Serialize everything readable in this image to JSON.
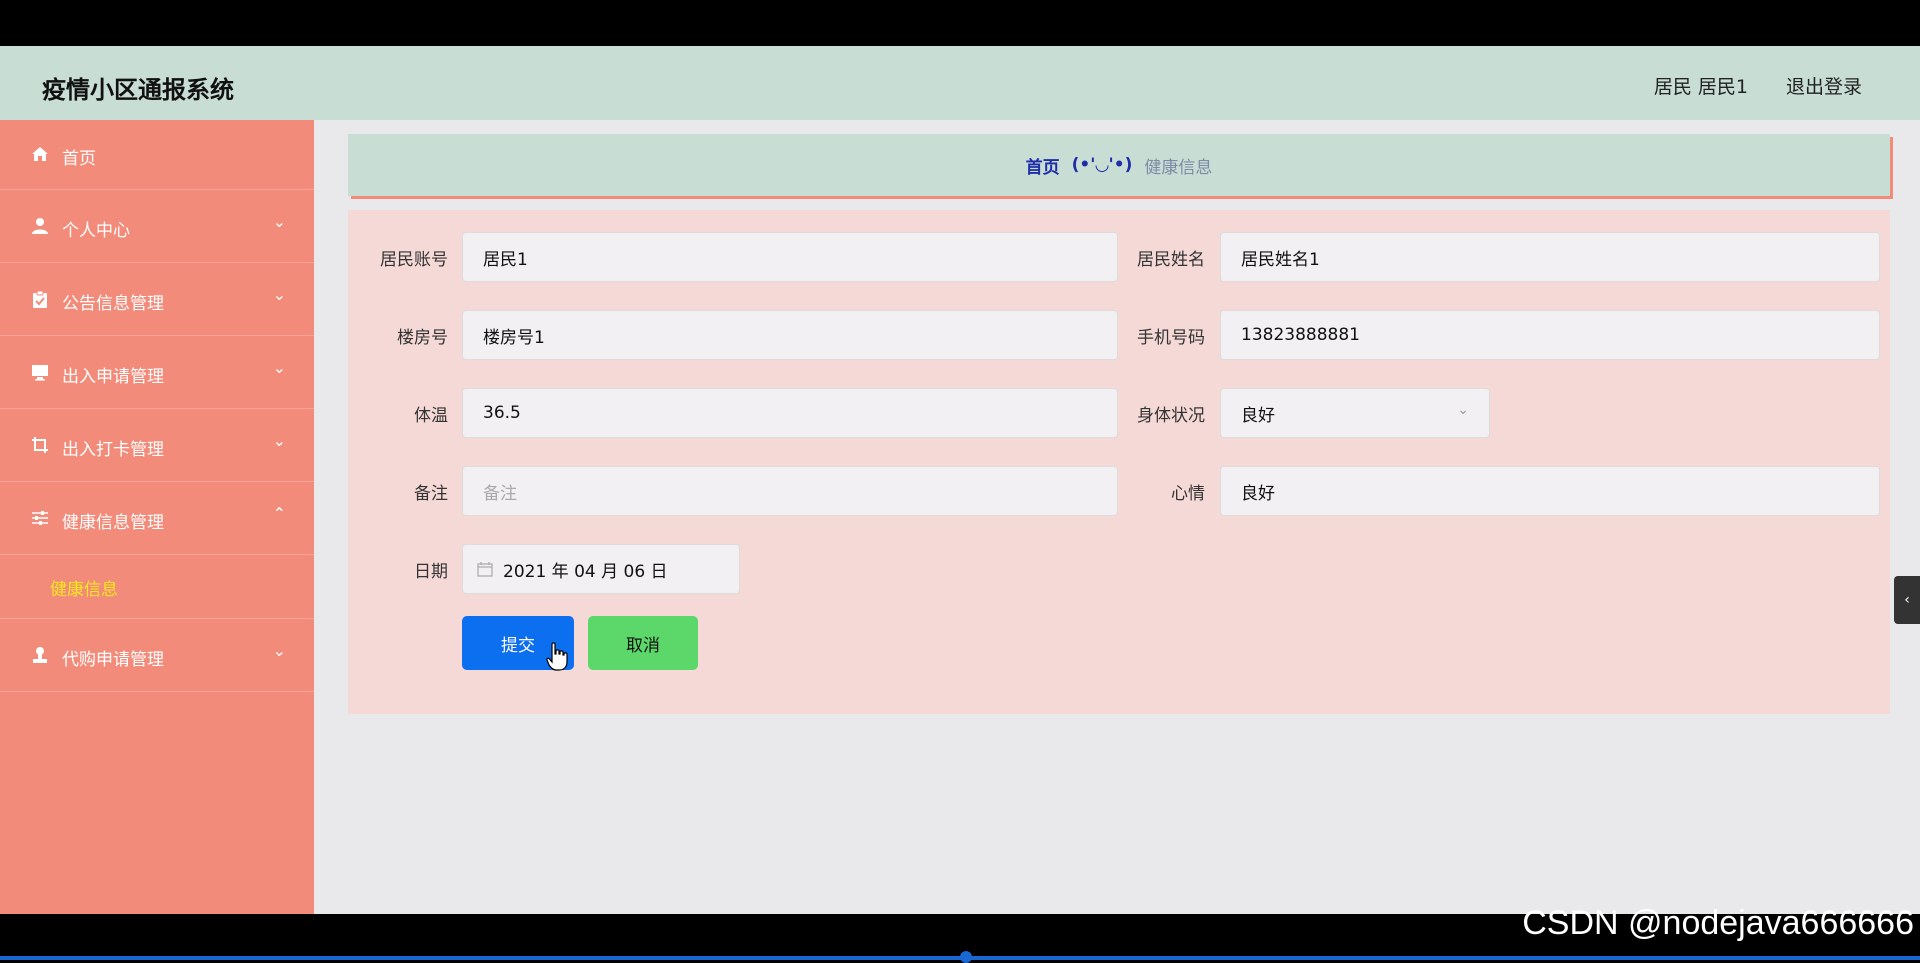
{
  "header": {
    "title": "疫情小区通报系统",
    "user_info": "居民 居民1",
    "logout": "退出登录"
  },
  "sidebar": {
    "items": [
      {
        "label": "首页",
        "icon": "home-icon"
      },
      {
        "label": "个人中心",
        "icon": "person-icon"
      },
      {
        "label": "公告信息管理",
        "icon": "clipboard-icon"
      },
      {
        "label": "出入申请管理",
        "icon": "monitor-icon"
      },
      {
        "label": "出入打卡管理",
        "icon": "crop-icon"
      },
      {
        "label": "健康信息管理",
        "icon": "sliders-icon"
      },
      {
        "label": "代购申请管理",
        "icon": "stamp-icon"
      }
    ],
    "sub_active": "健康信息"
  },
  "breadcrumb": {
    "home": "首页",
    "separator": "(•'◡'•)",
    "current": "健康信息"
  },
  "form": {
    "account_label": "居民账号",
    "account_value": "居民1",
    "name_label": "居民姓名",
    "name_value": "居民姓名1",
    "building_label": "楼房号",
    "building_value": "楼房号1",
    "phone_label": "手机号码",
    "phone_value": "13823888881",
    "temp_label": "体温",
    "temp_value": "36.5",
    "health_label": "身体状况",
    "health_value": "良好",
    "remark_label": "备注",
    "remark_placeholder": "备注",
    "mood_label": "心情",
    "mood_value": "良好",
    "date_label": "日期",
    "date_value": "2021 年 04 月 06 日",
    "submit": "提交",
    "cancel": "取消"
  },
  "watermark": "CSDN @nodejava666666",
  "colors": {
    "header_bg": "#c8ddd4",
    "sidebar_bg": "#f38b7a",
    "submenu_active": "#f5e81a",
    "form_bg": "#f5d9d6",
    "submit_bg": "#0b6ff0",
    "cancel_bg": "#5cd86a"
  }
}
